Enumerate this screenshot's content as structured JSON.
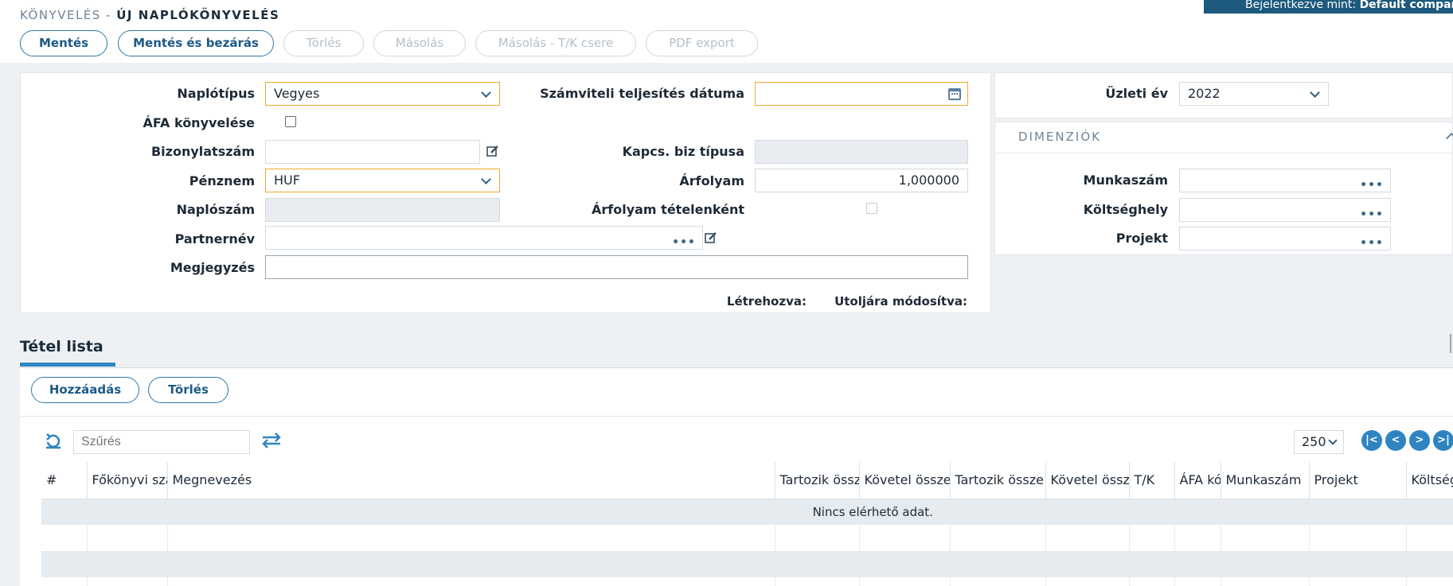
{
  "header": {
    "breadcrumb_root": "KÖNYVELÉS - ",
    "page_title": "ÚJ NAPLÓKÖNYVELÉS",
    "login_prefix": "Bejelentkezve mint: ",
    "login_user": "Default company"
  },
  "toolbar": {
    "save": "Mentés",
    "save_close": "Mentés és bezárás",
    "delete": "Törlés",
    "copy": "Másolás",
    "copy_swap": "Másolás - T/K csere",
    "pdf_export": "PDF export"
  },
  "form": {
    "journal_type_label": "Naplótípus",
    "journal_type_value": "Vegyes",
    "vat_booking_label": "ÁFA könyvelése",
    "voucher_no_label": "Bizonylatszám",
    "voucher_no_value": "",
    "currency_label": "Pénznem",
    "currency_value": "HUF",
    "journal_no_label": "Naplószám",
    "partner_label": "Partnernév",
    "partner_value": "",
    "note_label": "Megjegyzés",
    "note_value": "",
    "accounting_date_label": "Számviteli teljesítés dátuma",
    "accounting_date_value": "",
    "linked_doc_type_label": "Kapcs. biz típusa",
    "exchange_rate_label": "Árfolyam",
    "exchange_rate_value": "1,000000",
    "rate_per_item_label": "Árfolyam tételenként",
    "created_label": "Létrehozva:",
    "modified_label": "Utoljára módosítva:"
  },
  "fiscal": {
    "year_label": "Üzleti év",
    "year_value": "2022"
  },
  "dimensions": {
    "title": "DIMENZIÓK",
    "job_no_label": "Munkaszám",
    "cost_center_label": "Költséghely",
    "project_label": "Projekt"
  },
  "items": {
    "tab_label": "Tétel lista",
    "add_button": "Hozzáadás",
    "delete_button": "Törlés",
    "filter_placeholder": "Szűrés",
    "page_size": "250",
    "columns": [
      "#",
      "Főkönyvi szá",
      "Megnevezés",
      "Tartozik össz",
      "Követel össze",
      "Tartozik össze",
      "Követel össz",
      "T/K",
      "ÁFA kó",
      "Munkaszám",
      "Projekt",
      "Költség"
    ],
    "no_data": "Nincs elérhető adat."
  },
  "colors": {
    "accent": "#2d84bf",
    "required_border": "#f0a932",
    "badge_bg": "#1d5a7e"
  },
  "icons": [
    "calendar-icon",
    "edit-icon",
    "refresh-icon",
    "swap-icon",
    "first-page-icon",
    "prev-page-icon",
    "next-page-icon",
    "last-page-icon",
    "chevron-down-icon",
    "ellipsis-icon"
  ]
}
